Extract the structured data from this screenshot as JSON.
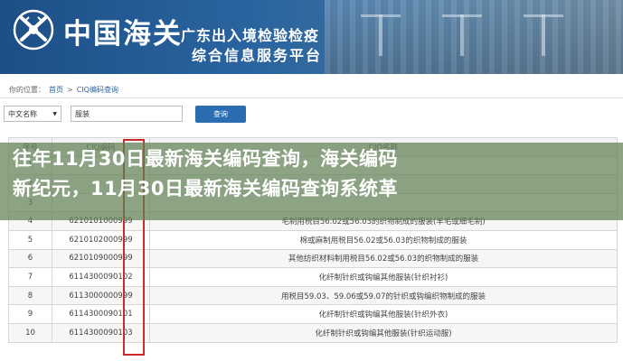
{
  "header": {
    "brand": "中国海关",
    "subtitle_line1": "广东出入境检验检疫",
    "subtitle_line2": "综合信息服务平台"
  },
  "breadcrumb": {
    "prefix": "你的位置：",
    "home": "首页",
    "sep": ">",
    "current": "CIQ编码查询"
  },
  "search": {
    "select_value": "中文名称",
    "input_value": "服装",
    "button_label": "查询"
  },
  "banner": {
    "line1": "往年11月30日最新海关编码查询，海关编码",
    "line2": "新纪元，11月30日最新海关编码查询系统革"
  },
  "table": {
    "headers": [
      "序号",
      "CIQ编码",
      "CIQ名称"
    ],
    "rows": [
      {
        "idx": "1",
        "code": "",
        "name": ""
      },
      {
        "idx": "2",
        "code": "",
        "name": ""
      },
      {
        "idx": "3",
        "code": "",
        "name": ""
      },
      {
        "idx": "4",
        "code": "6210101000999",
        "name": "毛制用税目56.02或56.03的织物制成的服装(羊毛或细毛制)"
      },
      {
        "idx": "5",
        "code": "6210102000999",
        "name": "棉或麻制用税目56.02或56.03的织物制成的服装"
      },
      {
        "idx": "6",
        "code": "6210109000999",
        "name": "其他纺织材料制用税目56.02或56.03的织物制成的服装"
      },
      {
        "idx": "7",
        "code": "6114300090102",
        "name": "化纤制针织或钩编其他服装(针织衬衫)"
      },
      {
        "idx": "8",
        "code": "6113000000999",
        "name": "用税目59.03、59.06或59.07的针织或钩编织物制成的服装"
      },
      {
        "idx": "9",
        "code": "6114300090101",
        "name": "化纤制针织或钩编其他服装(针织外衣)"
      },
      {
        "idx": "10",
        "code": "6114300090103",
        "name": "化纤制针织或钩编其他服装(针织运动服)"
      }
    ]
  },
  "colors": {
    "header_blue": "#1d4f86",
    "button_blue": "#2b6db0",
    "highlight_red": "#cc2a2a",
    "banner_green": "#608054"
  }
}
